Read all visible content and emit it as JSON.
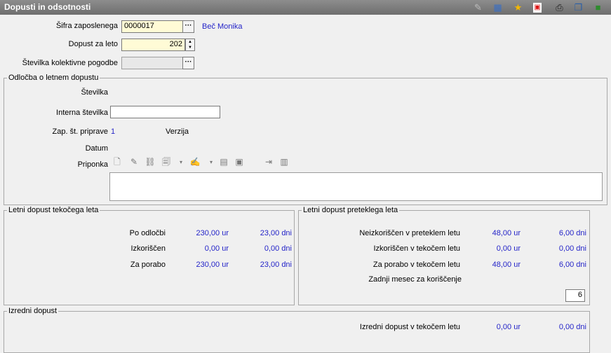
{
  "window": {
    "title": "Dopusti in odsotnosti",
    "toolbar_icons": [
      "edit-icon",
      "table-icon",
      "star-icon",
      "pdf-icon",
      "print-icon",
      "copy-icon",
      "book-icon"
    ]
  },
  "header": {
    "employee_code_label": "Šifra zaposlenega",
    "employee_code_value": "0000017",
    "employee_name": "Beč Monika",
    "leave_year_label": "Dopust za leto",
    "leave_year_value": "202",
    "collective_agreement_label": "Številka kolektivne pogodbe",
    "collective_agreement_value": ""
  },
  "decision": {
    "legend": "Odločba o letnem dopustu",
    "number_label": "Številka",
    "internal_number_label": "Interna številka",
    "internal_number_value": "",
    "prep_no_label": "Zap. št. priprave",
    "prep_no_value": "1",
    "version_label": "Verzija",
    "date_label": "Datum",
    "attachment_label": "Priponka",
    "attachment_tools": [
      "new-doc-icon",
      "edit-doc-icon",
      "link-icon",
      "open-doc-icon",
      "dropdown-icon",
      "sign-icon",
      "dropdown-icon",
      "scan-icon",
      "lock-icon",
      "export-icon",
      "import-icon"
    ]
  },
  "current_year": {
    "legend": "Letni dopust tekočega leta",
    "rows": [
      {
        "label": "Po odločbi",
        "amount": "230,00 ur",
        "days": "23,00 dni"
      },
      {
        "label": "Izkoriščen",
        "amount": "0,00 ur",
        "days": "0,00 dni"
      },
      {
        "label": "Za porabo",
        "amount": "230,00 ur",
        "days": "23,00 dni"
      }
    ]
  },
  "previous_year": {
    "legend": "Letni dopust preteklega leta",
    "rows": [
      {
        "label": "Neizkoriščen v preteklem letu",
        "amount": "48,00 ur",
        "days": "6,00 dni"
      },
      {
        "label": "Izkoriščen v tekočem letu",
        "amount": "0,00 ur",
        "days": "0,00 dni"
      },
      {
        "label": "Za porabo v tekočem letu",
        "amount": "48,00 ur",
        "days": "6,00 dni"
      }
    ],
    "last_month_label": "Zadnji mesec za koriščenje",
    "last_month_value": "6"
  },
  "extraordinary": {
    "legend": "Izredni dopust",
    "row": {
      "label": "Izredni dopust v tekočem letu",
      "amount": "0,00 ur",
      "days": "0,00 dni"
    }
  }
}
